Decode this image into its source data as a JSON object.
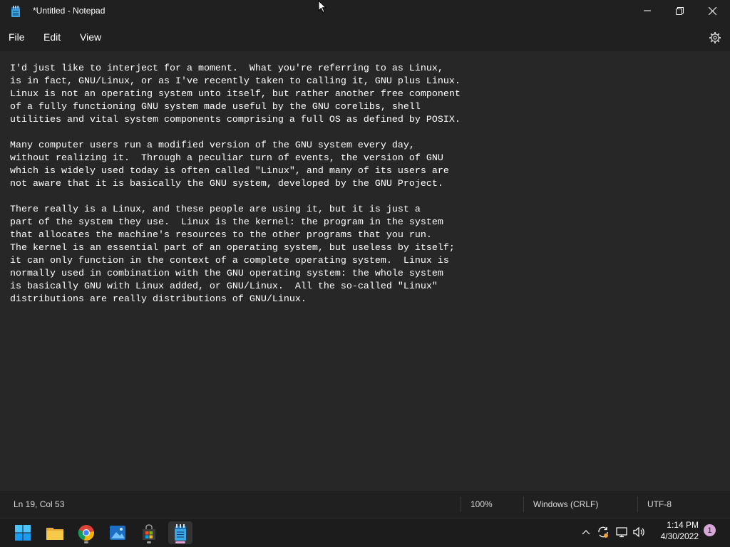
{
  "window": {
    "title": "*Untitled - Notepad"
  },
  "menu": {
    "file": "File",
    "edit": "Edit",
    "view": "View"
  },
  "editor": {
    "content": "I'd just like to interject for a moment.  What you're referring to as Linux,\nis in fact, GNU/Linux, or as I've recently taken to calling it, GNU plus Linux.\nLinux is not an operating system unto itself, but rather another free component\nof a fully functioning GNU system made useful by the GNU corelibs, shell\nutilities and vital system components comprising a full OS as defined by POSIX.\n\nMany computer users run a modified version of the GNU system every day,\nwithout realizing it.  Through a peculiar turn of events, the version of GNU\nwhich is widely used today is often called \"Linux\", and many of its users are\nnot aware that it is basically the GNU system, developed by the GNU Project.\n\nThere really is a Linux, and these people are using it, but it is just a\npart of the system they use.  Linux is the kernel: the program in the system\nthat allocates the machine's resources to the other programs that you run.\nThe kernel is an essential part of an operating system, but useless by itself;\nit can only function in the context of a complete operating system.  Linux is\nnormally used in combination with the GNU operating system: the whole system\nis basically GNU with Linux added, or GNU/Linux.  All the so-called \"Linux\"\ndistributions are really distributions of GNU/Linux."
  },
  "status": {
    "position": "Ln 19, Col 53",
    "zoom": "100%",
    "line_ending": "Windows (CRLF)",
    "encoding": "UTF-8"
  },
  "taskbar": {
    "apps": [
      "start-icon",
      "file-explorer-icon",
      "chrome-icon",
      "photos-icon",
      "store-icon",
      "notepad-icon"
    ],
    "time": "1:14 PM",
    "date": "4/30/2022",
    "notification_count": "1"
  },
  "colors": {
    "background": "#202020",
    "editor": "#272727",
    "accent": "#0078d4"
  }
}
